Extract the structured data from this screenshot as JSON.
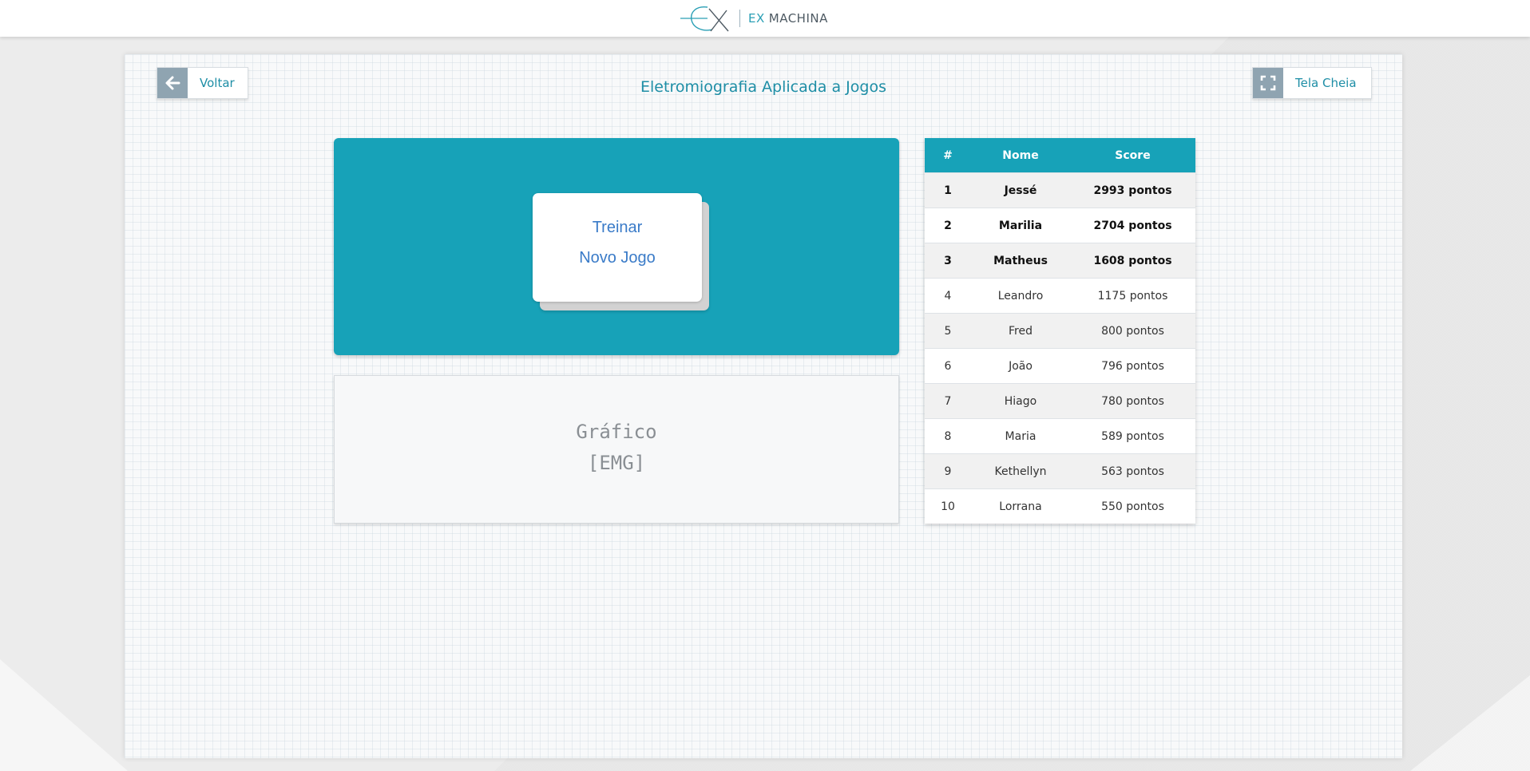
{
  "header": {
    "logo_icon": "ex-logo-icon",
    "logo_ex": "EX",
    "logo_name": "MACHINA"
  },
  "page": {
    "title": "Eletromiografia Aplicada a Jogos"
  },
  "nav": {
    "back_label": "Voltar",
    "back_icon": "arrow-left-icon",
    "fullscreen_label": "Tela Cheia",
    "fullscreen_icon": "fullscreen-icon"
  },
  "game_menu": {
    "train_label": "Treinar",
    "new_game_label": "Novo Jogo"
  },
  "graph": {
    "line1": "Gráfico",
    "line2": "[EMG]"
  },
  "ranking": {
    "headers": [
      "#",
      "Nome",
      "Score"
    ],
    "rows": [
      {
        "pos": "1",
        "name": "Jessé",
        "score": "2993 pontos"
      },
      {
        "pos": "2",
        "name": "Marilia",
        "score": "2704 pontos"
      },
      {
        "pos": "3",
        "name": "Matheus",
        "score": "1608 pontos"
      },
      {
        "pos": "4",
        "name": "Leandro",
        "score": "1175 pontos"
      },
      {
        "pos": "5",
        "name": "Fred",
        "score": "800 pontos"
      },
      {
        "pos": "6",
        "name": "João",
        "score": "796 pontos"
      },
      {
        "pos": "7",
        "name": "Hiago",
        "score": "780 pontos"
      },
      {
        "pos": "8",
        "name": "Maria",
        "score": "589 pontos"
      },
      {
        "pos": "9",
        "name": "Kethellyn",
        "score": "563 pontos"
      },
      {
        "pos": "10",
        "name": "Lorrana",
        "score": "550 pontos"
      }
    ]
  },
  "colors": {
    "accent": "#17a2b8",
    "title_text": "#1e8ea6",
    "menu_text": "#3a7bc8",
    "nav_icon_bg": "#8fa4b1"
  }
}
